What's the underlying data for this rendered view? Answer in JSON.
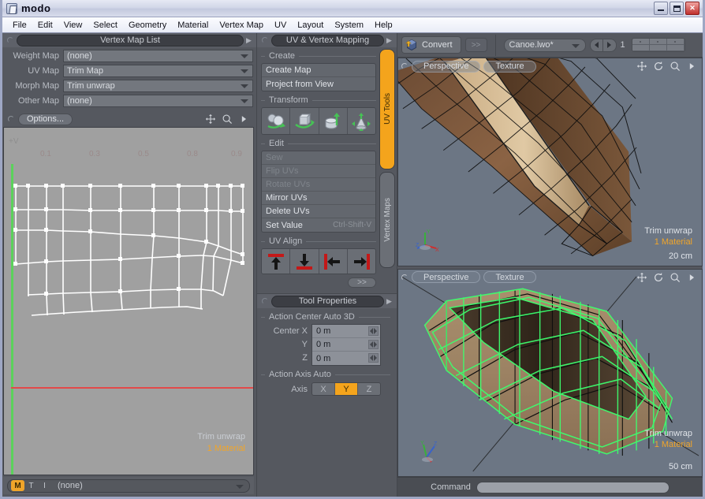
{
  "window": {
    "title": "modo",
    "icon": "app-icon",
    "controls": {
      "minimize": "–",
      "maximize": "□",
      "close": "✕"
    }
  },
  "menubar": {
    "items": [
      "File",
      "Edit",
      "View",
      "Select",
      "Geometry",
      "Material",
      "Vertex Map",
      "UV",
      "Layout",
      "System",
      "Help"
    ]
  },
  "vertex_map_panel": {
    "title": "Vertex Map List",
    "rows": [
      {
        "label": "Weight Map",
        "value": "(none)"
      },
      {
        "label": "UV Map",
        "value": "Trim Map"
      },
      {
        "label": "Morph Map",
        "value": "Trim unwrap"
      },
      {
        "label": "Other Map",
        "value": "(none)"
      }
    ]
  },
  "uv_editor": {
    "options_label": "Options...",
    "tools": [
      "pan-icon",
      "zoom-icon",
      "chevron-right-icon"
    ],
    "v_axis_label": "+V",
    "ticks": [
      "0.1",
      "0.3",
      "0.5",
      "0.8",
      "0.9"
    ],
    "status_name": "Trim unwrap",
    "status_material": "1 Material",
    "footer": {
      "modes": [
        "M",
        "T",
        "I"
      ],
      "active_mode": "M",
      "value": "(none)"
    },
    "colors": {
      "background": "#a0a0a0",
      "wire": "#ffffff",
      "v_axis": "#5bd25b",
      "u_axis": "#e24a4a"
    }
  },
  "uv_mapping_panel": {
    "title": "UV & Vertex Mapping",
    "vertical_tabs": [
      {
        "label": "UV Tools",
        "active": true
      },
      {
        "label": "Vertex Maps",
        "active": false
      }
    ],
    "groups": [
      {
        "title": "Create",
        "type": "list",
        "items": [
          {
            "label": "Create Map",
            "disabled": false,
            "shortcut": ""
          },
          {
            "label": "Project from View",
            "disabled": false,
            "shortcut": ""
          }
        ]
      },
      {
        "title": "Transform",
        "type": "icons",
        "items": [
          {
            "label": "move-tool-icon"
          },
          {
            "label": "rotate-tool-icon"
          },
          {
            "label": "scale-tool-icon"
          },
          {
            "label": "stretch-tool-icon"
          }
        ]
      },
      {
        "title": "Edit",
        "type": "list",
        "items": [
          {
            "label": "Sew",
            "disabled": true,
            "shortcut": ""
          },
          {
            "label": "Flip UVs",
            "disabled": true,
            "shortcut": ""
          },
          {
            "label": "Rotate UVs",
            "disabled": true,
            "shortcut": ""
          },
          {
            "label": "Mirror UVs",
            "disabled": false,
            "shortcut": ""
          },
          {
            "label": "Delete UVs",
            "disabled": false,
            "shortcut": ""
          },
          {
            "label": "Set Value",
            "disabled": false,
            "shortcut": "Ctrl-Shift-V"
          }
        ]
      },
      {
        "title": "UV Align",
        "type": "align",
        "items": [
          {
            "label": "align-top-icon"
          },
          {
            "label": "align-bottom-icon"
          },
          {
            "label": "align-left-icon"
          },
          {
            "label": "align-right-icon"
          }
        ]
      }
    ],
    "expander_label": ">>"
  },
  "tool_properties": {
    "title": "Tool Properties",
    "section_center": "Action Center Auto 3D",
    "center_fields": [
      {
        "label": "Center X",
        "value": "0 m"
      },
      {
        "label": "Y",
        "value": "0 m"
      },
      {
        "label": "Z",
        "value": "0 m"
      }
    ],
    "section_axis": "Action Axis Auto",
    "axis_label": "Axis",
    "axis_options": [
      "X",
      "Y",
      "Z"
    ],
    "axis_selected": "Y"
  },
  "toolbar": {
    "convert_label": "Convert",
    "convert_icon": "convert-icon",
    "expander_label": ">>",
    "file_selector": "Canoe.lwo*",
    "layer_index": "1",
    "nav_prev": "prev-layer-icon",
    "nav_next": "next-layer-icon"
  },
  "viewports": [
    {
      "name": "viewport-top",
      "view_label": "Perspective",
      "shading_label": "Texture",
      "status_name": "Trim unwrap",
      "status_material": "1 Material",
      "scale": "20 cm",
      "icons": [
        "pan-icon",
        "rotate-icon",
        "zoom-icon",
        "chevron-right-icon"
      ],
      "wire_color": "#111111"
    },
    {
      "name": "viewport-bottom",
      "view_label": "Perspective",
      "shading_label": "Texture",
      "status_name": "Trim unwrap",
      "status_material": "1 Material",
      "scale": "50 cm",
      "icons": [
        "pan-icon",
        "rotate-icon",
        "zoom-icon",
        "chevron-right-icon"
      ],
      "wire_color": "#3dff6e"
    }
  ],
  "command_bar": {
    "label": "Command",
    "value": "",
    "placeholder": ""
  }
}
